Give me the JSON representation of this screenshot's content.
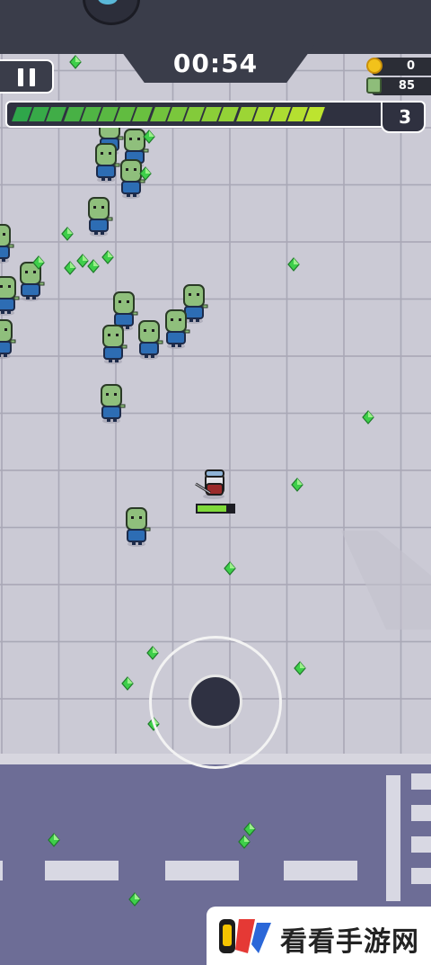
{
  "hud": {
    "timer": "00:54",
    "coins": "0",
    "kills": "85",
    "level": "3",
    "xp_progress": 0.86
  },
  "controls": {
    "pause_icon": "pause-icon",
    "joystick": "virtual-joystick"
  },
  "watermark": {
    "text": "看看手游网",
    "logo": "kkshouyou-logo"
  },
  "colors": {
    "hud_dark": "#3a3d4a",
    "floor": "#c9c8d3",
    "road": "#6d6d96",
    "xp_green_start": "#2fa64a",
    "xp_green_end": "#d6ef2a",
    "gem": "#3ecf4a",
    "zombie_skin": "#8fbf7c",
    "zombie_shirt": "#2d6db4"
  }
}
